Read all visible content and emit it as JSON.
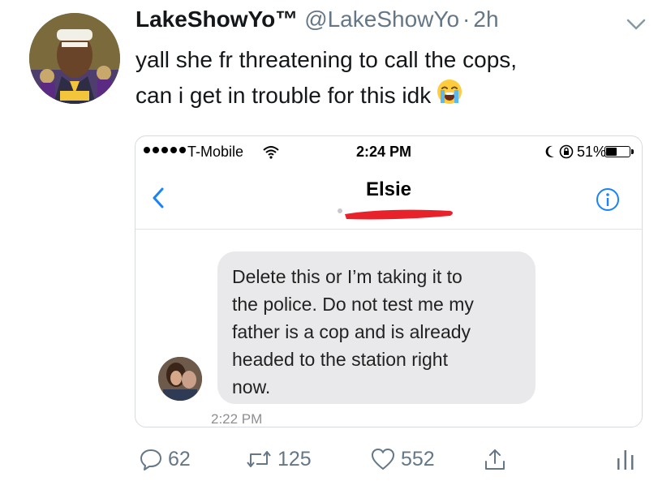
{
  "tweet": {
    "display_name": "LakeShowYo™",
    "handle": "@LakeShowYo",
    "separator": "·",
    "time": "2h",
    "text_lines": [
      "yall she fr threatening to call the cops,",
      "can i get in trouble for this idk"
    ],
    "emoji": "loudly-crying-face"
  },
  "screenshot": {
    "status_bar": {
      "carrier": "T-Mobile",
      "clock": "2:24 PM",
      "battery": "51%",
      "battery_level": 0.51
    },
    "contact_name": "Elsie",
    "message_lines": [
      "Delete this or I’m taking it to",
      "the police. Do not test me my",
      "father is a cop and is already",
      "headed to the station right",
      "now."
    ],
    "message_time": "2:22 PM",
    "colors": {
      "accent": "#1a82fb",
      "bubble": "#e9e9eb",
      "redaction": "#e8222a"
    }
  },
  "actions": {
    "replies": "62",
    "retweets": "125",
    "likes": "552"
  },
  "icons": [
    "chevron-down-icon",
    "back-chevron-icon",
    "info-icon",
    "reply-icon",
    "retweet-icon",
    "like-icon",
    "share-icon",
    "analytics-icon"
  ]
}
